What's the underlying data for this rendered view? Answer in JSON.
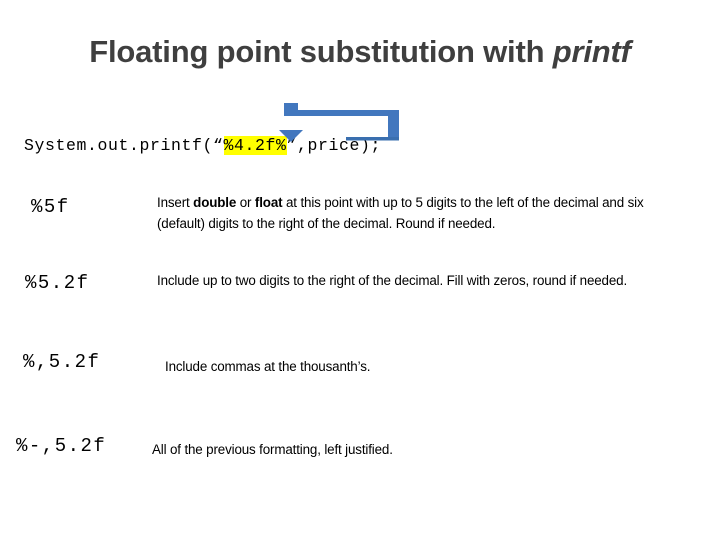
{
  "slide": {
    "title_prefix": "Floating point substitution with ",
    "title_keyword": "printf",
    "background_color": "#ffffff",
    "title_color": "#3f3f3f"
  },
  "code": {
    "before_highlight": "System.out.printf(“",
    "highlight": "%4.2f%",
    "after_highlight": "”,price);",
    "highlight_color": "#ffff00"
  },
  "arrow": {
    "name": "loop-arrow",
    "color": "#4277be",
    "description": "blue arrow from price argument back to the format specifier"
  },
  "rows": [
    {
      "format": "%5f",
      "desc_part_1": "Insert ",
      "desc_bold_1": "double",
      "desc_part_2": " or ",
      "desc_bold_2": "float",
      "desc_part_3": " at this point with up to 5 digits to the left of the decimal and six (default) digits to the right of the decimal.  Round if needed."
    },
    {
      "format": "%5.2f",
      "desc": "Include up to two digits to the right of the decimal.   Fill with zeros, round if needed."
    },
    {
      "format": "%,5.2f",
      "desc": "Include commas at the thousanth’s."
    },
    {
      "format": "%-,5.2f",
      "desc": "All of the previous formatting, left justified."
    }
  ]
}
